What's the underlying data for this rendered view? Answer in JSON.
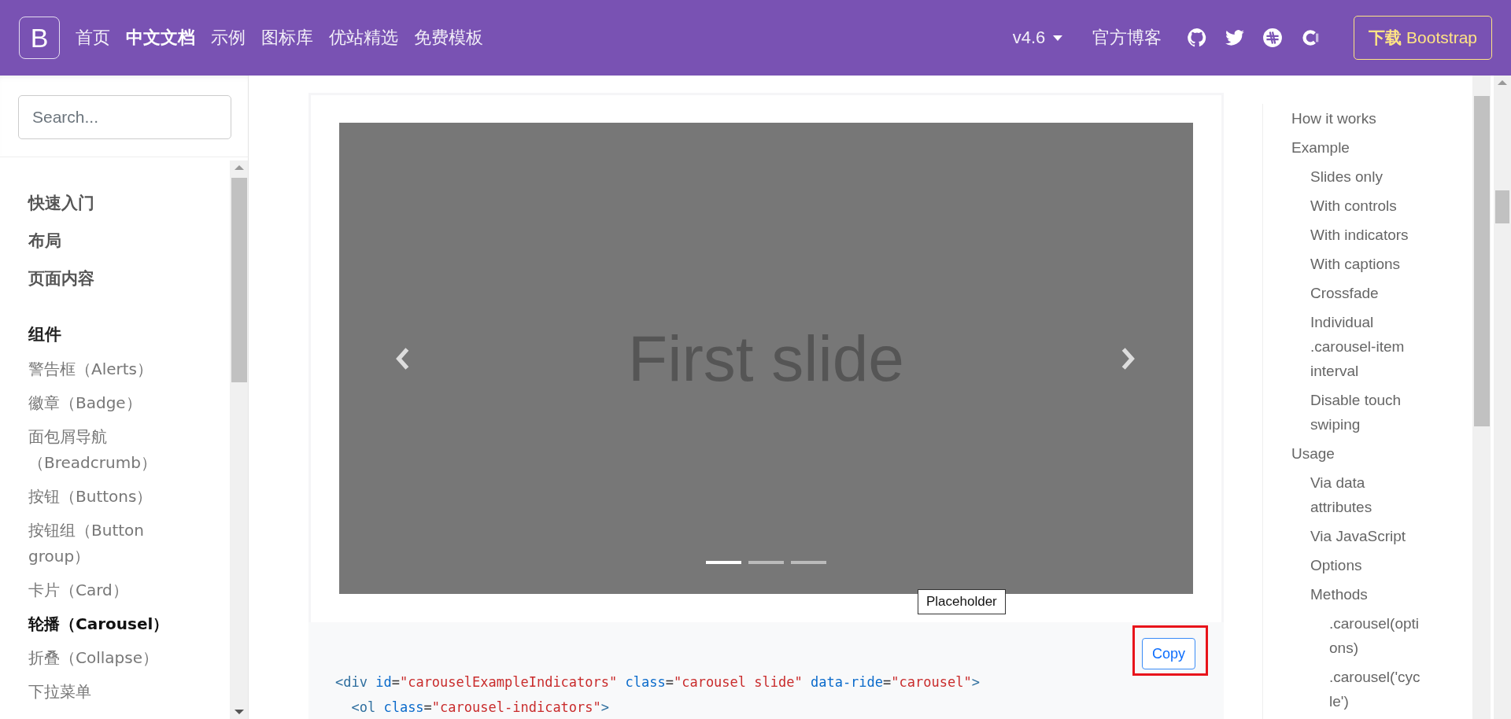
{
  "navbar": {
    "logo": "B",
    "links": [
      {
        "label": "首页",
        "selected": false
      },
      {
        "label": "中文文档",
        "selected": true
      },
      {
        "label": "示例",
        "selected": false
      },
      {
        "label": "图标库",
        "selected": false
      },
      {
        "label": "优站精选",
        "selected": false
      },
      {
        "label": "免费模板",
        "selected": false
      }
    ],
    "version": "v4.6",
    "blog": "官方博客",
    "download": {
      "prefix": "下载",
      "name": "Bootstrap"
    }
  },
  "sidebar": {
    "search": {
      "placeholder": "Search..."
    },
    "items": [
      {
        "kind": "section",
        "label": "快速入门",
        "selected": false
      },
      {
        "kind": "section",
        "label": "布局",
        "selected": false
      },
      {
        "kind": "section",
        "label": "页面内容",
        "selected": false
      },
      {
        "kind": "heading",
        "label": "组件",
        "selected": false
      },
      {
        "kind": "link",
        "label": "警告框（Alerts）",
        "selected": false
      },
      {
        "kind": "link",
        "label": "徽章（Badge）",
        "selected": false
      },
      {
        "kind": "link",
        "label": "面包屑导航（Breadcrumb）",
        "selected": false
      },
      {
        "kind": "link",
        "label": "按钮（Buttons）",
        "selected": false
      },
      {
        "kind": "link",
        "label": "按钮组（Button group）",
        "selected": false
      },
      {
        "kind": "link",
        "label": "卡片（Card）",
        "selected": false
      },
      {
        "kind": "link",
        "label": "轮播（Carousel）",
        "selected": true
      },
      {
        "kind": "link",
        "label": "折叠（Collapse）",
        "selected": false
      },
      {
        "kind": "link",
        "label": "下拉菜单",
        "selected": false
      }
    ]
  },
  "example": {
    "slide_caption": "First slide",
    "indicators": [
      {
        "selected": true
      },
      {
        "selected": false
      },
      {
        "selected": false
      }
    ],
    "tooltip": "Placeholder",
    "copy_button": {
      "label": "Copy",
      "highlighted": true
    },
    "code_lines": [
      [
        {
          "kind": "tag",
          "s": "<div "
        },
        {
          "kind": "attr",
          "s": "id"
        },
        {
          "kind": "punct",
          "s": "="
        },
        {
          "kind": "str",
          "s": "\"carouselExampleIndicators\" "
        },
        {
          "kind": "attr",
          "s": "class"
        },
        {
          "kind": "punct",
          "s": "="
        },
        {
          "kind": "str",
          "s": "\"carousel slide\" "
        },
        {
          "kind": "attr",
          "s": "data-ride"
        },
        {
          "kind": "punct",
          "s": "="
        },
        {
          "kind": "str",
          "s": "\"carousel\""
        },
        {
          "kind": "tag",
          "s": ">"
        }
      ],
      [
        {
          "kind": "tag",
          "s": "  <ol "
        },
        {
          "kind": "attr",
          "s": "class"
        },
        {
          "kind": "punct",
          "s": "="
        },
        {
          "kind": "str",
          "s": "\"carousel-indicators\""
        },
        {
          "kind": "tag",
          "s": ">"
        }
      ]
    ]
  },
  "toc": [
    {
      "label": "How it works"
    },
    {
      "label": "Example",
      "children": [
        {
          "label": "Slides only"
        },
        {
          "label": "With controls"
        },
        {
          "label": "With indicators"
        },
        {
          "label": "With captions"
        },
        {
          "label": "Crossfade"
        },
        {
          "label": "Individual .carousel-item interval"
        },
        {
          "label": "Disable touch swiping"
        }
      ]
    },
    {
      "label": "Usage",
      "children": [
        {
          "label": "Via data attributes"
        },
        {
          "label": "Via JavaScript"
        },
        {
          "label": "Options"
        },
        {
          "label": "Methods",
          "children": [
            {
              "label": ".carousel(options)"
            },
            {
              "label": ".carousel('cycle')"
            }
          ]
        }
      ]
    }
  ]
}
